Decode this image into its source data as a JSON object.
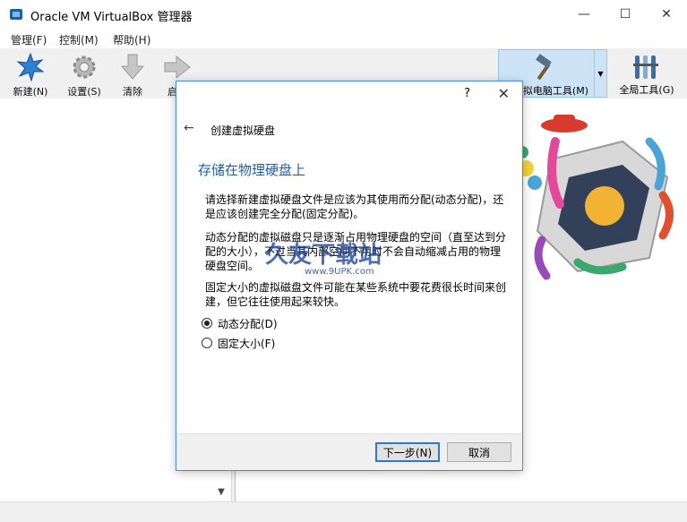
{
  "window": {
    "title": "Oracle VM VirtualBox 管理器",
    "minimize": "—",
    "maximize": "☐",
    "close": "✕"
  },
  "menu": [
    "管理(F)",
    "控制(M)",
    "帮助(H)"
  ],
  "toolbar": {
    "new_label": "新建(N)",
    "settings_label": "设置(S)",
    "discard_label": "清除",
    "start_label": "启动",
    "machine_tools_label": "拟电脑工具(M)",
    "global_tools_label": "全局工具(G)"
  },
  "dialog": {
    "help": "?",
    "close": "✕",
    "back": "←",
    "title": "创建虚拟硬盘",
    "heading": "存储在物理硬盘上",
    "intro": "请选择新建虚拟硬盘文件是应该为其使用而分配(动态分配)，还是应该创建完全分配(固定分配)。",
    "dynamic_desc": "动态分配的虚拟磁盘只是逐渐占用物理硬盘的空间（直至达到分配的大小），不过当其内部空间不用时不会自动缩减占用的物理硬盘空间。",
    "fixed_desc": "固定大小的虚拟磁盘文件可能在某些系统中要花费很长时间来创建，但它往往使用起来较快。",
    "options": [
      {
        "label": "动态分配(D)",
        "checked": true
      },
      {
        "label": "固定大小(F)",
        "checked": false
      }
    ],
    "next_button": "下一步(N)",
    "cancel_button": "取消"
  },
  "watermark": {
    "brand": "久友下载站",
    "url": "www.9UPK.com"
  },
  "colors": {
    "accent": "#2a79d7",
    "heading": "#1f5fa8",
    "tools_bg": "#cde4f7"
  }
}
